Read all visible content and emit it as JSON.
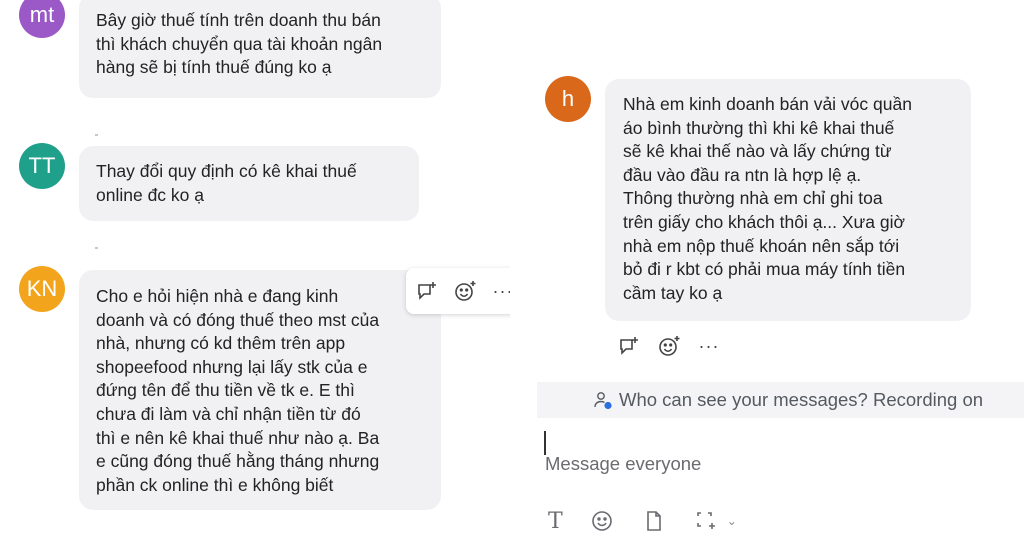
{
  "left_pane": {
    "messages": [
      {
        "avatar_initials": "mt",
        "avatar_color": "#9b59c7",
        "lines": [
          "Bây giờ thuế tính trên doanh thu bán",
          "thì khách chuyển qua tài khoản ngân",
          "hàng sẽ bị tính thuế đúng ko ạ"
        ]
      },
      {
        "avatar_initials": "TT",
        "avatar_color": "#1fa08a",
        "lines": [
          "Thay đổi quy định có kê khai thuế",
          "online đc ko ạ"
        ]
      },
      {
        "avatar_initials": "KN",
        "avatar_color": "#f2a51c",
        "lines": [
          "Cho e hỏi hiện nhà e đang kinh",
          "doanh và có đóng thuế theo mst của",
          "nhà, nhưng có kd thêm trên app",
          "shopeefood nhưng lại lấy stk của e",
          "đứng tên để thu tiền về tk e. E thì",
          "chưa đi làm và chỉ nhận tiền từ đó",
          "thì e nên kê khai thuế như nào ạ. Ba",
          "e cũng đóng thuế hằng tháng nhưng",
          "phần ck online thì e không biết"
        ]
      }
    ],
    "hover_actions": {
      "reply_icon": "reply-bubble-icon",
      "react_icon": "add-reaction-icon",
      "more_label": "···"
    }
  },
  "right_pane": {
    "message": {
      "avatar_initials": "h",
      "avatar_color": "#d9681a",
      "lines": [
        "Nhà em kinh doanh bán vải vóc quần",
        "áo bình thường thì khi kê khai thuế",
        "sẽ kê khai thế nào và lấy chứng từ",
        "đầu vào đầu ra ntn là hợp lệ ạ.",
        "Thông thường nhà em chỉ ghi toa",
        "trên giấy cho khách thôi ạ... Xưa giờ",
        "nhà em nộp thuế khoán nên sắp tới",
        "bỏ đi r kbt có phải mua máy tính tiền",
        "cầm tay ko ạ"
      ]
    },
    "reaction_actions": {
      "reply_icon": "reply-bubble-icon",
      "react_icon": "add-reaction-icon",
      "more_label": "···"
    },
    "notice": {
      "icon": "privacy-person-icon",
      "text": "Who can see your messages? Recording on"
    },
    "composer": {
      "placeholder": "Message everyone",
      "toolbar": {
        "format_label": "T",
        "emoji_icon": "emoji-icon",
        "file_icon": "file-icon",
        "screenshot_icon": "screenshot-icon",
        "chevron_label": "⌄"
      }
    }
  },
  "colors": {
    "bubble": "#f1f1f3",
    "notice_bg": "#f4f4f6",
    "text": "#232323"
  }
}
